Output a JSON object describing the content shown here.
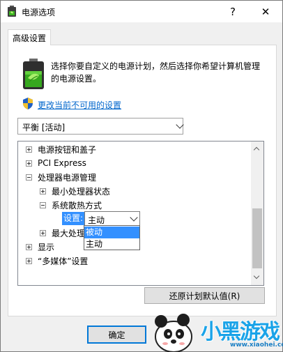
{
  "window": {
    "title": "电源选项",
    "help_glyph": "?",
    "close_glyph": "✕"
  },
  "tab": {
    "label": "高级设置"
  },
  "description": "选择你要自定义的电源计划，然后选择你希望计算机管理的电源设置。",
  "change_link": "更改当前不可用的设置",
  "plan_select": {
    "value": "平衡 [活动]"
  },
  "tree": {
    "items": [
      {
        "label": "电源按钮和盖子",
        "state": "collapsed"
      },
      {
        "label": "PCI Express",
        "state": "collapsed"
      },
      {
        "label": "处理器电源管理",
        "state": "expanded"
      },
      {
        "label": "最小处理器状态",
        "state": "collapsed"
      },
      {
        "label": "系统散热方式",
        "state": "expanded"
      },
      {
        "label": "最大处理",
        "state": "collapsed"
      },
      {
        "label": "显示",
        "state": "collapsed"
      },
      {
        "label": "“多媒体”设置",
        "state": "collapsed"
      }
    ],
    "setting_label": "设置:",
    "setting_value": "主动"
  },
  "dropdown": {
    "options": [
      "被动",
      "主动"
    ],
    "highlighted": "被动"
  },
  "buttons": {
    "restore": "还原计划默认值(R)",
    "ok": "确定"
  },
  "watermark": {
    "text": "小黑游戏",
    "url": "www.xiaohei.com"
  },
  "icons": {
    "title": "battery-leaf-icon",
    "power_plan": "battery-power-plan-icon",
    "uac": "uac-shield-icon"
  },
  "colors": {
    "accent": "#0078d7",
    "selection": "#3390ff",
    "link": "#0066cc",
    "watermark_blue": "#1aa3e8"
  }
}
